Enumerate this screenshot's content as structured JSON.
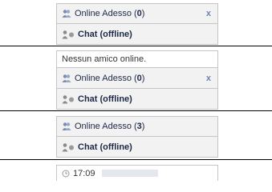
{
  "blocks": [
    {
      "online_label": "Online Adesso",
      "online_count": "0",
      "close": "x",
      "chat_label": "Chat (offline)"
    },
    {
      "message": "Nessun amico online.",
      "online_label": "Online Adesso",
      "online_count": "0",
      "close": "x",
      "chat_label": "Chat (offline)"
    },
    {
      "online_label": "Online Adesso",
      "online_count": "3",
      "chat_label": "Chat (offline)"
    }
  ],
  "partial": {
    "time": "17:09"
  },
  "icons": {
    "friends": "friends-icon",
    "status": "user-offline-icon",
    "clock": "clock-icon"
  },
  "colors": {
    "panel_bg": "#f2f2f2",
    "border": "#c5c5c5",
    "close": "#6d84b4",
    "separator": "#000000"
  }
}
